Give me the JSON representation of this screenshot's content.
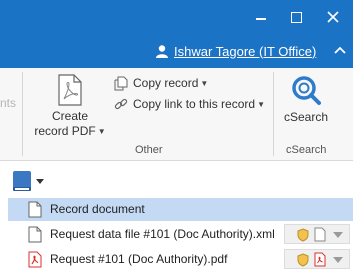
{
  "titlebar": {
    "user_name": "Ishwar Tagore (IT Office)",
    "accent": "#1b73c6"
  },
  "ribbon": {
    "partial_label": "nts",
    "create_pdf": {
      "line1": "Create",
      "line2": "record PDF",
      "icon": "pdf-document-icon"
    },
    "copy_record": {
      "label": "Copy record",
      "icon": "copy-icon"
    },
    "copy_link": {
      "label": "Copy link to this record",
      "icon": "link-icon"
    },
    "group_other": "Other",
    "csearch": {
      "label": "cSearch",
      "icon": "csearch-icon"
    },
    "group_csearch": "cSearch"
  },
  "list": {
    "rows": [
      {
        "label": "Record document",
        "icon": "document-icon",
        "selected": true
      },
      {
        "label": "Request data file #101 (Doc Authority).xml",
        "icon": "document-icon",
        "selected": false
      },
      {
        "label": "Request #101 (Doc Authority).pdf",
        "icon": "pdf-icon",
        "selected": false
      }
    ]
  },
  "colors": {
    "selected_row": "#c4d9f3",
    "pdf_red": "#d9302c",
    "shield_yellow": "#f2c14e"
  }
}
